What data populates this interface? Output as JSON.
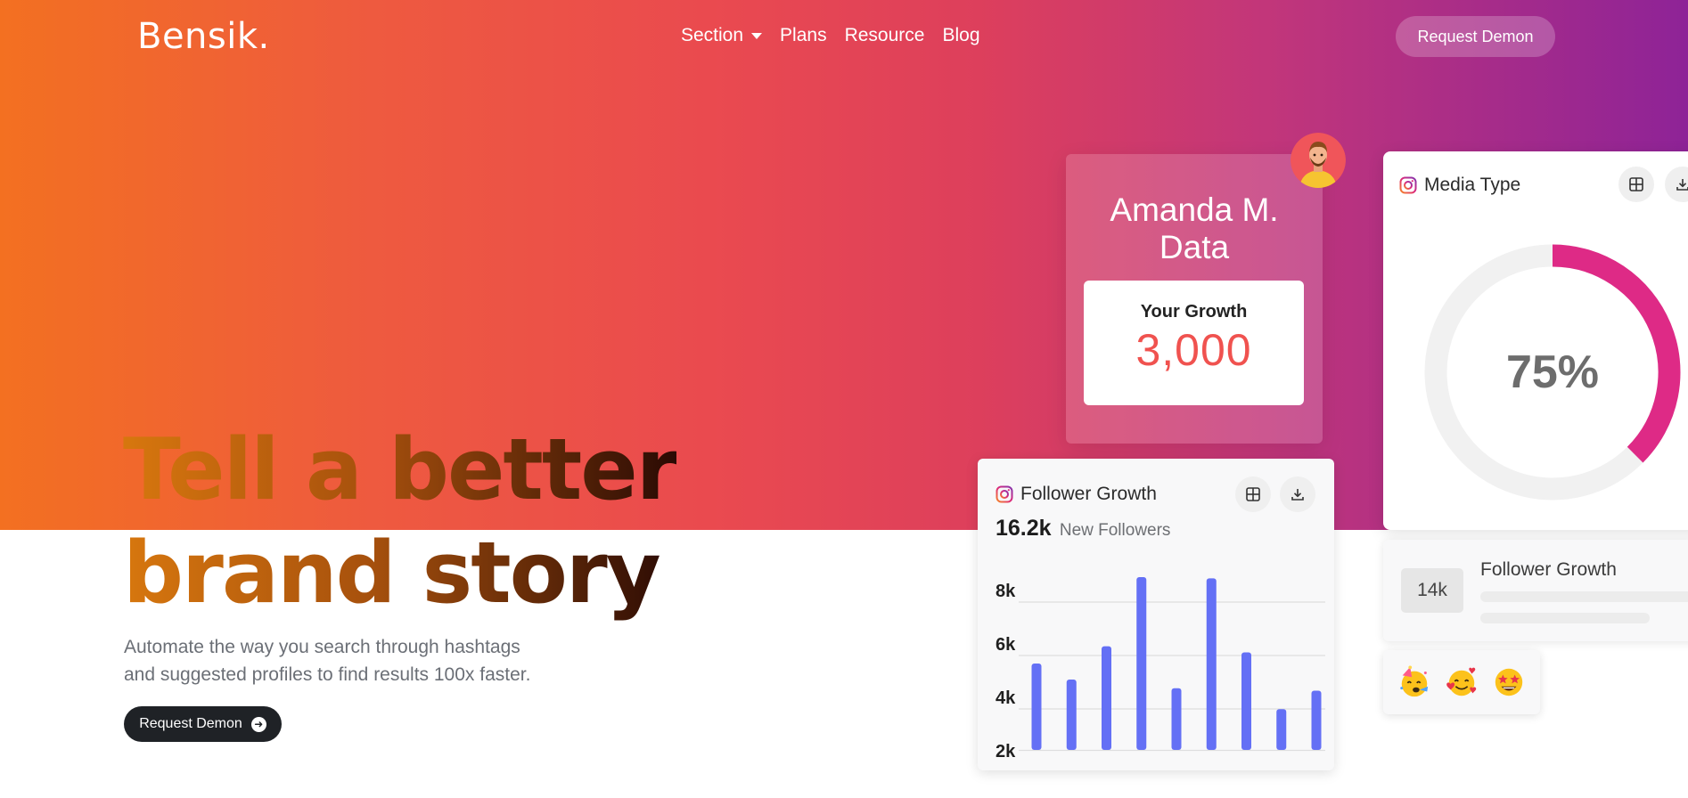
{
  "header": {
    "logo": "Bensik.",
    "nav": [
      {
        "label": "Section",
        "has_dropdown": true
      },
      {
        "label": "Plans"
      },
      {
        "label": "Resource"
      },
      {
        "label": "Blog"
      }
    ],
    "cta": "Request Demon"
  },
  "hero": {
    "title_line1": "Tell a better",
    "title_line2": "brand story",
    "subtitle_line1": "Automate the way you search through hashtags",
    "subtitle_line2": "and suggested profiles to find results 100x faster.",
    "cta": "Request Demon"
  },
  "profile_card": {
    "name_line1": "Amanda M.",
    "name_line2": "Data",
    "growth_label": "Your Growth",
    "growth_value": "3,000"
  },
  "media_card": {
    "title": "Media Type",
    "icon": "instagram-icon",
    "percent_label": "75%"
  },
  "follower_card": {
    "title": "Follower Growth",
    "icon": "instagram-icon",
    "stat_value": "16.2k",
    "stat_label": "New Followers"
  },
  "growth_card_2": {
    "badge": "14k",
    "title": "Follower Growth"
  },
  "emoji_card": {
    "emojis": [
      "partying-face-emoji",
      "smiling-face-with-hearts-emoji",
      "star-struck-emoji"
    ]
  },
  "colors": {
    "gradient_start": "#f37021",
    "gradient_end": "#8e2397",
    "accent_pink": "#de2a86",
    "bar_blue": "#6470f5",
    "growth_red": "#f0524f"
  },
  "chart_data": [
    {
      "type": "bar",
      "title": "Follower Growth",
      "y_ticks": [
        "8k",
        "6k",
        "4k",
        "2k"
      ],
      "ylim": [
        2000,
        8000
      ],
      "values": [
        4700,
        4050,
        5400,
        8200,
        3700,
        8150,
        5150,
        2850,
        3600
      ],
      "grid": true
    },
    {
      "type": "pie",
      "title": "Media Type",
      "values": [
        75,
        25
      ],
      "center_label": "75%"
    }
  ]
}
